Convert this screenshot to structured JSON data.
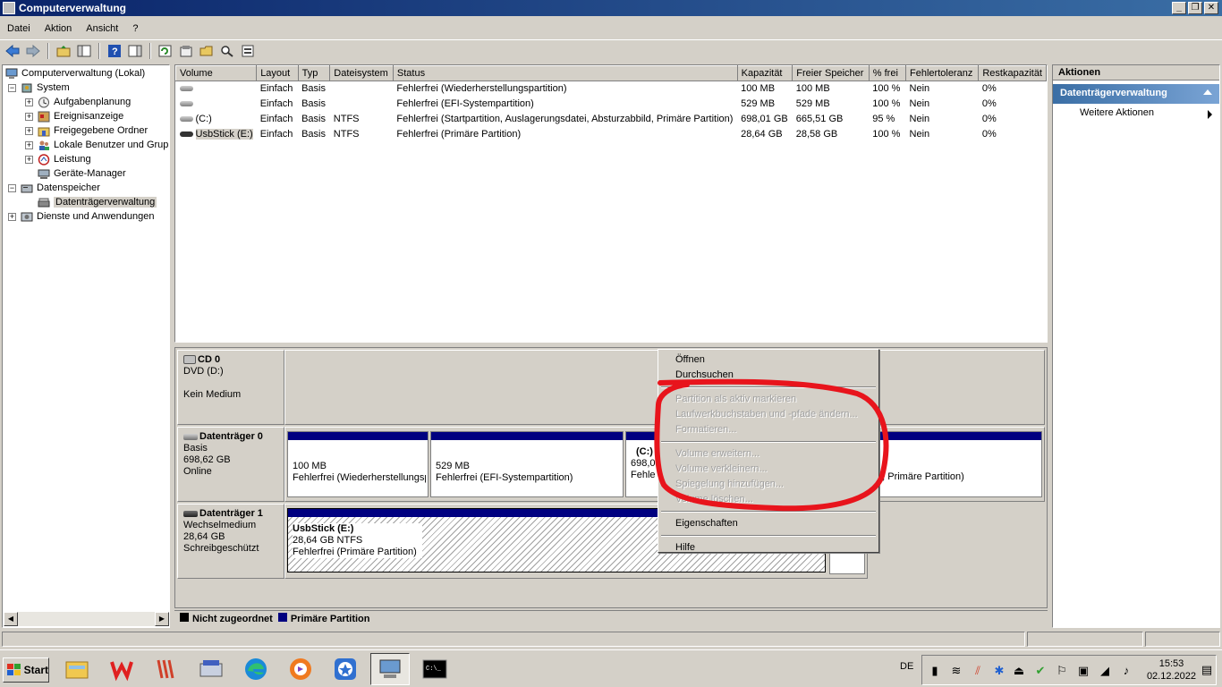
{
  "window": {
    "title": "Computerverwaltung",
    "minimize": "_",
    "restore": "❐",
    "close": "✕"
  },
  "menu": [
    "Datei",
    "Aktion",
    "Ansicht",
    "?"
  ],
  "tree": {
    "root": "Computerverwaltung (Lokal)",
    "system": "System",
    "items": [
      "Aufgabenplanung",
      "Ereignisanzeige",
      "Freigegebene Ordner",
      "Lokale Benutzer und Gruppen",
      "Leistung",
      "Geräte-Manager"
    ],
    "storage": "Datenspeicher",
    "disk_mgmt": "Datenträgerverwaltung",
    "services": "Dienste und Anwendungen"
  },
  "volume_table": {
    "columns": [
      "Volume",
      "Layout",
      "Typ",
      "Dateisystem",
      "Status",
      "Kapazität",
      "Freier Speicher",
      "% frei",
      "Fehlertoleranz",
      "Restkapazität"
    ],
    "rows": [
      [
        "",
        "Einfach",
        "Basis",
        "",
        "Fehlerfrei (Wiederherstellungspartition)",
        "100 MB",
        "100 MB",
        "100 %",
        "Nein",
        "0%"
      ],
      [
        "",
        "Einfach",
        "Basis",
        "",
        "Fehlerfrei (EFI-Systempartition)",
        "529 MB",
        "529 MB",
        "100 %",
        "Nein",
        "0%"
      ],
      [
        "(C:)",
        "Einfach",
        "Basis",
        "NTFS",
        "Fehlerfrei (Startpartition, Auslagerungsdatei, Absturzabbild, Primäre Partition)",
        "698,01 GB",
        "665,51 GB",
        "95 %",
        "Nein",
        "0%"
      ],
      [
        "UsbStick (E:)",
        "Einfach",
        "Basis",
        "NTFS",
        "Fehlerfrei (Primäre Partition)",
        "28,64 GB",
        "28,58 GB",
        "100 %",
        "Nein",
        "0%"
      ]
    ]
  },
  "disks": {
    "cd0": {
      "name": "CD 0",
      "type": "DVD (D:)",
      "status": "Kein Medium"
    },
    "disk0": {
      "name": "Datenträger 0",
      "type": "Basis",
      "size": "698,62 GB",
      "status": "Online",
      "parts": [
        {
          "size": "100 MB",
          "desc": "Fehlerfrei (Wiederherstellungspartition)"
        },
        {
          "size": "529 MB",
          "desc": "Fehlerfrei (EFI-Systempartition)"
        },
        {
          "name": "(C:)",
          "size": "698,0",
          "desc": "Fehle"
        },
        {
          "desc_tail": "d, Primäre Partition)"
        }
      ]
    },
    "disk1": {
      "name": "Datenträger 1",
      "type": "Wechselmedium",
      "size": "28,64 GB",
      "status": "Schreibgeschützt",
      "part": {
        "name": "UsbStick  (E:)",
        "size": "28,64 GB NTFS",
        "desc": "Fehlerfrei (Primäre Partition)"
      }
    }
  },
  "legend": {
    "unallocated": "Nicht zugeordnet",
    "primary": "Primäre Partition",
    "unallocated_color": "#000000",
    "primary_color": "#000080"
  },
  "actions": {
    "header": "Aktionen",
    "section": "Datenträgerverwaltung",
    "more": "Weitere Aktionen"
  },
  "context_menu": {
    "open": "Öffnen",
    "browse": "Durchsuchen",
    "mark_active": "Partition als aktiv markieren",
    "change_letter": "Laufwerkbuchstaben und -pfade ändern...",
    "format": "Formatieren...",
    "extend": "Volume erweitern...",
    "shrink": "Volume verkleinern...",
    "mirror": "Spiegelung hinzufügen...",
    "delete": "Volume löschen...",
    "properties": "Eigenschaften",
    "help": "Hilfe"
  },
  "annotation_color": "#e8141c",
  "taskbar": {
    "start": "Start",
    "apps": [
      "explorer-icon",
      "wps-office-icon",
      "wps-writer-icon",
      "keyboard-icon",
      "edge-icon",
      "browser-icon",
      "star-app-icon",
      "computer-management-icon",
      "command-prompt-icon"
    ],
    "lang": "DE",
    "time": "15:53",
    "date": "02.12.2022"
  }
}
